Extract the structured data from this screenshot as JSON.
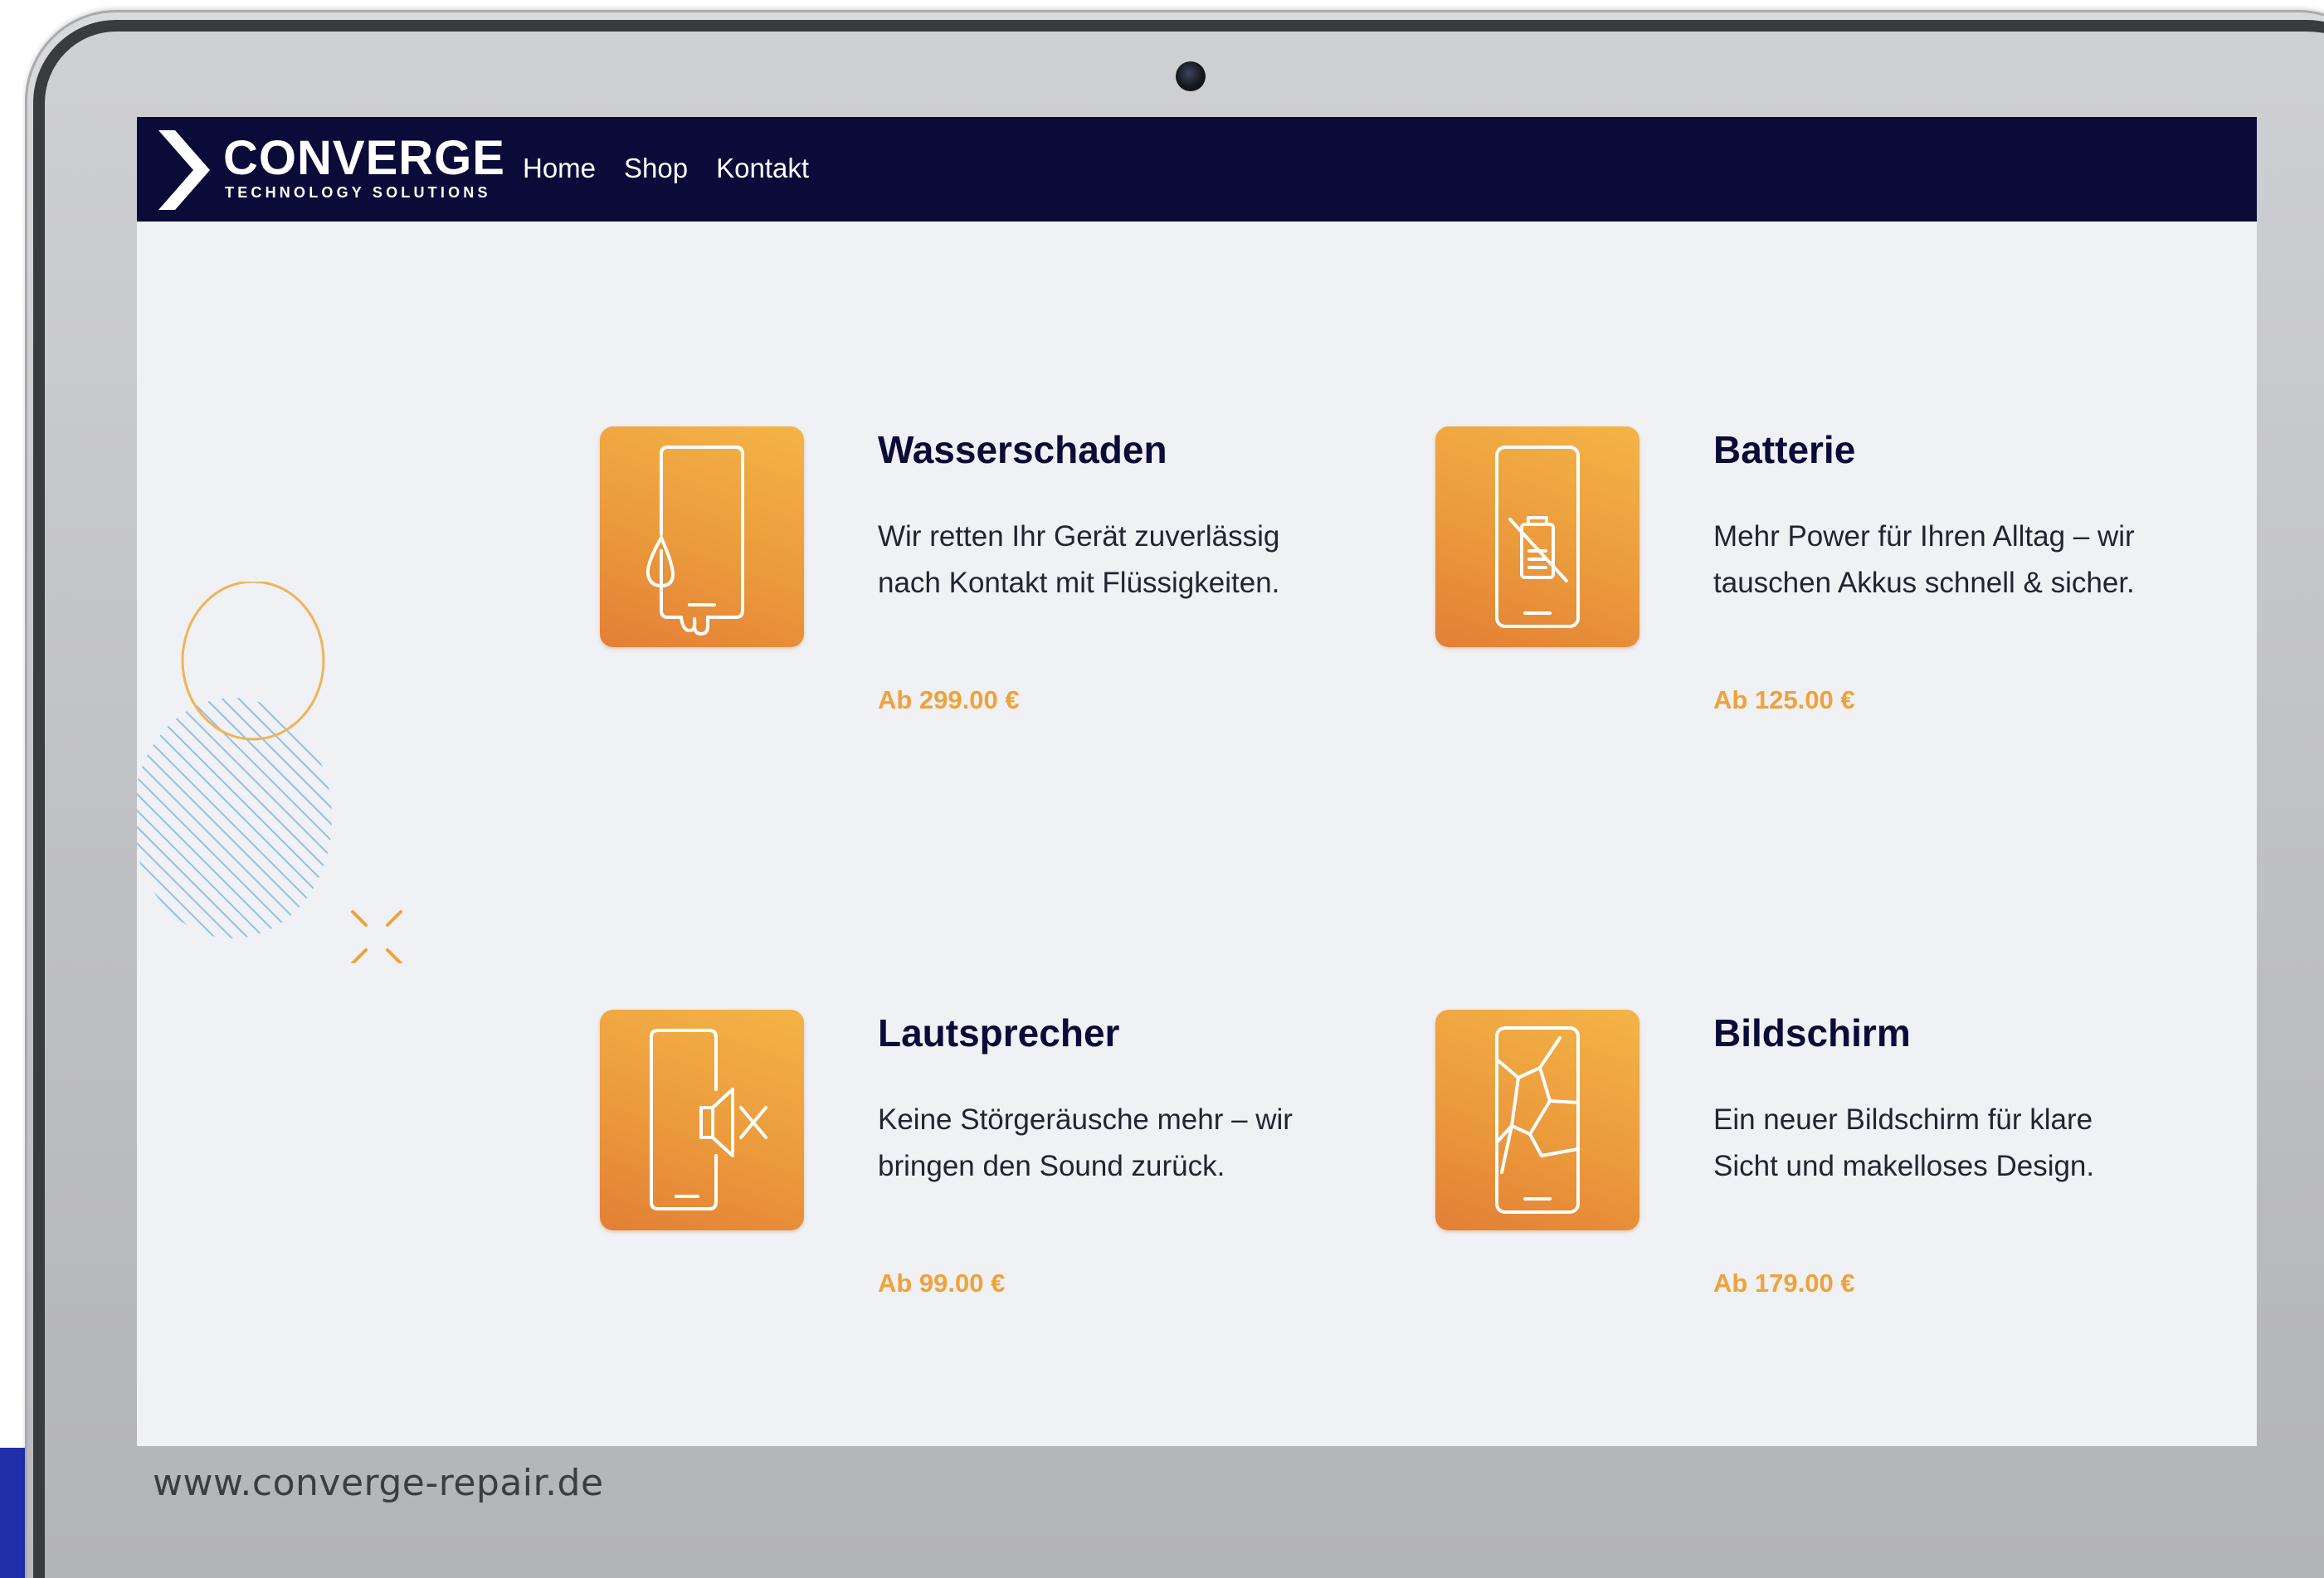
{
  "brand": {
    "name": "CONVERGE",
    "tagline": "TECHNOLOGY SOLUTIONS"
  },
  "nav": {
    "items": [
      {
        "label": "Home"
      },
      {
        "label": "Shop"
      },
      {
        "label": "Kontakt"
      }
    ]
  },
  "services": [
    {
      "title": "Wasserschaden",
      "description": "Wir retten Ihr Gerät zuverlässig nach Kontakt mit Flüssigkeiten.",
      "price": "Ab 299.00 €",
      "icon": "phone-water-drop-icon"
    },
    {
      "title": "Batterie",
      "description": "Mehr Power für Ihren Alltag – wir tauschen  Akkus schnell & sicher.",
      "price": "Ab 125.00 €",
      "icon": "phone-battery-icon"
    },
    {
      "title": "Lautsprecher",
      "description": "Keine Störgeräusche mehr – wir bringen den Sound zurück.",
      "price": "Ab 99.00 €",
      "icon": "phone-speaker-muted-icon"
    },
    {
      "title": "Bildschirm",
      "description": "Ein neuer Bildschirm für klare Sicht und makelloses Design.",
      "price": "Ab 179.00 €",
      "icon": "phone-cracked-screen-icon"
    }
  ],
  "footer": {
    "url": "www.converge-repair.de"
  },
  "colors": {
    "navbar": "#0a0b38",
    "accent_orange": "#f0a13a",
    "title_navy": "#0a0b38",
    "screen_background": "#f0f1f4",
    "deco_stripes": "#8fc0ea",
    "corner_accent": "#1e2fa8"
  }
}
